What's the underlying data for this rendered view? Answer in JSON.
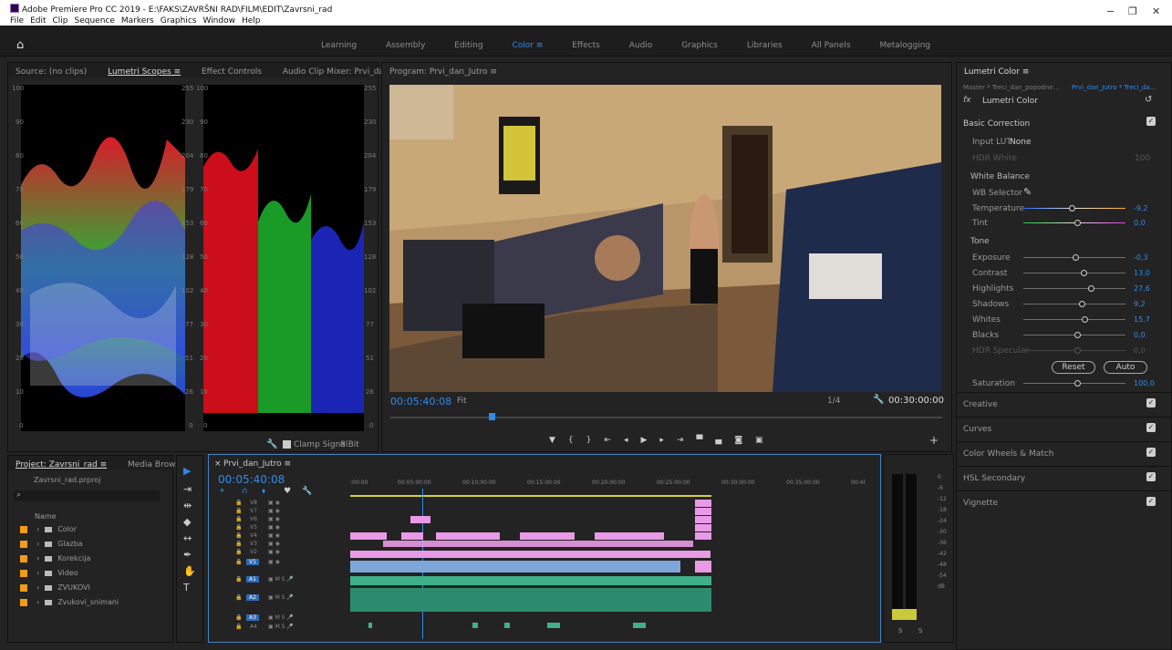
{
  "window": {
    "title": "Adobe Premiere Pro CC 2019 - E:\\FAKS\\ZAVRŠNI RAD\\FILM\\EDIT\\Zavrsni_rad",
    "minimize": "−",
    "restore": "❐",
    "close": "✕"
  },
  "menu": [
    "File",
    "Edit",
    "Clip",
    "Sequence",
    "Markers",
    "Graphics",
    "Window",
    "Help"
  ],
  "workspaces": {
    "items": [
      "Learning",
      "Assembly",
      "Editing",
      "Color",
      "Effects",
      "Audio",
      "Graphics",
      "Libraries",
      "All Panels",
      "Metalogging"
    ],
    "active": "Color",
    "active_suffix": "≡"
  },
  "source_panel": {
    "tabs": [
      "Source: (no clips)",
      "Lumetri Scopes ≡",
      "Effect Controls",
      "Audio Clip Mixer: Prvi_dan_Jutro"
    ],
    "active": "Lumetri Scopes ≡",
    "left_ticks": [
      "100",
      "90",
      "80",
      "70",
      "60",
      "50",
      "40",
      "30",
      "20",
      "10",
      "0"
    ],
    "right_ticks": [
      "255",
      "230",
      "204",
      "179",
      "153",
      "128",
      "102",
      "77",
      "51",
      "26",
      "0"
    ],
    "mid_ticks": [
      "100",
      "90",
      "80",
      "70",
      "60",
      "50",
      "40",
      "30",
      "20",
      "10",
      "0"
    ],
    "clamp_label": "Clamp Signal",
    "bit_label": "8 Bit"
  },
  "program": {
    "title": "Program: Prvi_dan_Jutro ≡",
    "timecode": "00:05:40:08",
    "fit": "Fit",
    "resolution": "1/4",
    "duration": "00:30:00:00"
  },
  "lumetri": {
    "panel_title": "Lumetri Color ≡",
    "master": "Master * Treci_dan_popodne...",
    "clip": "Prvi_dan_Jutro * Treci_da...",
    "effect": "Lumetri Color",
    "basic": "Basic Correction",
    "input_lut_label": "Input LUT",
    "input_lut": "None",
    "hdr_white_label": "HDR White",
    "hdr_white": "100",
    "white_balance": "White Balance",
    "wb_selector": "WB Selector",
    "tone": "Tone",
    "sliders": [
      {
        "label": "Temperature",
        "value": "-9,2"
      },
      {
        "label": "Tint",
        "value": "0,0"
      },
      {
        "label": "Exposure",
        "value": "-0,3"
      },
      {
        "label": "Contrast",
        "value": "13,0"
      },
      {
        "label": "Highlights",
        "value": "27,6"
      },
      {
        "label": "Shadows",
        "value": "9,2"
      },
      {
        "label": "Whites",
        "value": "15,7"
      },
      {
        "label": "Blacks",
        "value": "0,0"
      },
      {
        "label": "HDR Specular",
        "value": "0,0"
      },
      {
        "label": "Saturation",
        "value": "100,0"
      }
    ],
    "reset": "Reset",
    "auto": "Auto",
    "sections": [
      "Creative",
      "Curves",
      "Color Wheels & Match",
      "HSL Secondary",
      "Vignette"
    ]
  },
  "project": {
    "tabs": [
      "Project: Zavrsni_rad ≡",
      "Media Browser",
      "»"
    ],
    "file": "Zavrsni_rad.prproj",
    "name_header": "Name",
    "items": [
      "Color",
      "Glazba",
      "Korekcija",
      "Video",
      "ZVUKOVI",
      "Zvukovi_snimani"
    ]
  },
  "timeline": {
    "title": "Prvi_dan_Jutro ≡",
    "timecode": "00:05:40:08",
    "ruler": [
      ":00:00",
      "00:05:00:00",
      "00:10:00:00",
      "00:15:00:00",
      "00:20:00:00",
      "00:25:00:00",
      "00:30:00:00",
      "00:35:00:00",
      "00:4("
    ],
    "video_tracks": [
      "V8",
      "V7",
      "V6",
      "V5",
      "V4",
      "V3",
      "V2",
      "V1"
    ],
    "audio_tracks": [
      "A1",
      "A2",
      "A3",
      "A4"
    ],
    "meter_ticks": [
      "0",
      "-6",
      "-12",
      "-18",
      "-24",
      "-30",
      "-36",
      "-42",
      "-48",
      "-54",
      "dB"
    ],
    "meter_solo": [
      "S",
      "S"
    ]
  },
  "colors": {
    "accent": "#2d8ceb",
    "clip_pink": "#e99ae6",
    "audio_green": "#3fb08a",
    "audio_track": "#4a8fd8"
  }
}
